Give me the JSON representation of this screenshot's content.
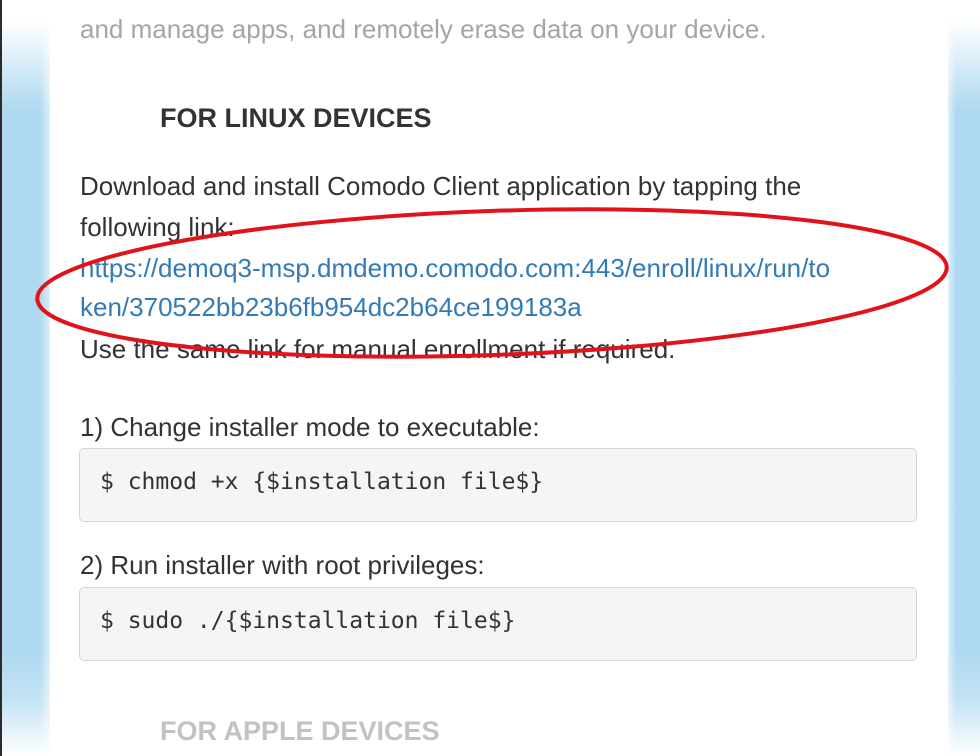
{
  "intro": {
    "text": "and manage apps, and remotely erase data on your device."
  },
  "linux": {
    "heading": "FOR LINUX DEVICES",
    "instruction_line1": "Download and install Comodo Client application by tapping the",
    "instruction_line2": "following link:",
    "link_line1": "https://demoq3-msp.dmdemo.comodo.com:443/enroll/linux/run/to",
    "link_line2": "ken/370522bb23b6fb954dc2b64ce199183a",
    "manual_note": "Use the same link for manual enrollment if required.",
    "step1_label": "1) Change installer mode to executable:",
    "step1_code": "$ chmod +x {$installation file$}",
    "step2_label": "2) Run installer with root privileges:",
    "step2_code": "$ sudo ./{$installation file$}"
  },
  "apple": {
    "heading": "FOR APPLE DEVICES"
  },
  "colors": {
    "link": "#337ab7",
    "annotation": "#e0131b",
    "side_panel": "#aed9f0"
  }
}
